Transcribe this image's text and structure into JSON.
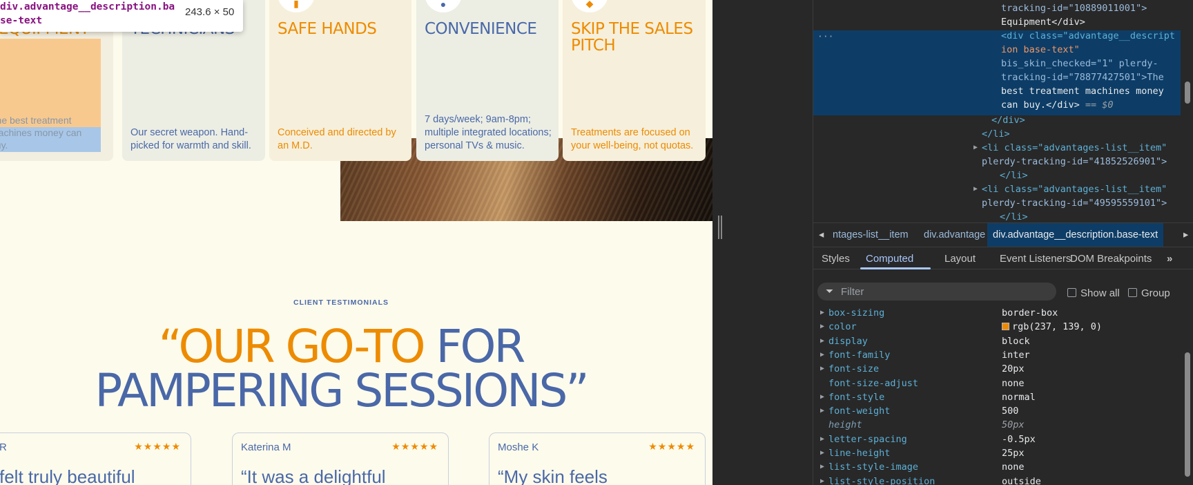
{
  "tooltip": {
    "element": "div.advantage__description.base-text",
    "size": "243.6 × 50"
  },
  "cards": [
    {
      "title": "EQUIPMENT",
      "desc": "The best treatment machines money can buy."
    },
    {
      "title": "TECHNICIANS",
      "desc": "Our secret weapon. Hand-picked for warmth and skill."
    },
    {
      "title": "SAFE HANDS",
      "desc": "Conceived and directed by an M.D."
    },
    {
      "title": "CONVENIENCE",
      "desc": "7 days/week; 9am-8pm; multiple integrated locations; personal TVs & music."
    },
    {
      "title": "SKIP THE SALES PITCH",
      "desc": "Treatments are focused on your well-being, not quotas."
    }
  ],
  "testimonials": {
    "eyebrow": "CLIENT TESTIMONIALS",
    "headline_orange": "“OUR GO-TO",
    "headline_blue_1": " FOR",
    "headline_blue_2": "PAMPERING SESSIONS”",
    "reviews": [
      {
        "name": "R",
        "stars": "★★★★★",
        "quote": "felt truly beautiful"
      },
      {
        "name": "Katerina M",
        "stars": "★★★★★",
        "quote": "“It was a delightful"
      },
      {
        "name": "Moshe K",
        "stars": "★★★★★",
        "quote": "“My skin feels"
      }
    ]
  },
  "devtools": {
    "dom_lines": {
      "l1a": "tracking-id=\"10889011001\">",
      "l2": "Equipment</div>",
      "l3a": "<div class=\"advantage__descript",
      "l4": "ion base-text\"",
      "l5": "bis_skin_checked=\"1\" plerdy-",
      "l6": "tracking-id=\"78877427501\">The",
      "l7": "best treatment machines money",
      "l8a": "can buy.</div>",
      "l8b": " == $0",
      "l9": "</div>",
      "l10": "</li>",
      "l11": "<li class=\"advantages-list__item\"",
      "l12": "plerdy-tracking-id=\"41852526901\">",
      "l13": "</li>",
      "l14": "<li class=\"advantages-list__item\"",
      "l15": "plerdy-tracking-id=\"49595559101\">",
      "l16": "</li>"
    },
    "breadcrumbs": [
      "ntages-list__item",
      "div.advantage",
      "div.advantage__description.base-text"
    ],
    "tabs": [
      "Styles",
      "Computed",
      "Layout",
      "Event Listeners",
      "DOM Breakpoints"
    ],
    "active_tab": "Computed",
    "filter_placeholder": "Filter",
    "show_all_label": "Show all",
    "group_label": "Group",
    "color_swatch": "#ed8b00",
    "properties": [
      {
        "name": "box-sizing",
        "value": "border-box",
        "inherited": false
      },
      {
        "name": "color",
        "value": "rgb(237, 139, 0)",
        "inherited": false
      },
      {
        "name": "display",
        "value": "block",
        "inherited": false
      },
      {
        "name": "font-family",
        "value": "inter",
        "inherited": false
      },
      {
        "name": "font-size",
        "value": "20px",
        "inherited": false
      },
      {
        "name": "font-size-adjust",
        "value": "none",
        "inherited": false
      },
      {
        "name": "font-style",
        "value": "normal",
        "inherited": false
      },
      {
        "name": "font-weight",
        "value": "500",
        "inherited": false
      },
      {
        "name": "height",
        "value": "50px",
        "inherited": true
      },
      {
        "name": "letter-spacing",
        "value": "-0.5px",
        "inherited": false
      },
      {
        "name": "line-height",
        "value": "25px",
        "inherited": false
      },
      {
        "name": "list-style-image",
        "value": "none",
        "inherited": false
      },
      {
        "name": "list-style-position",
        "value": "outside",
        "inherited": false
      }
    ]
  }
}
